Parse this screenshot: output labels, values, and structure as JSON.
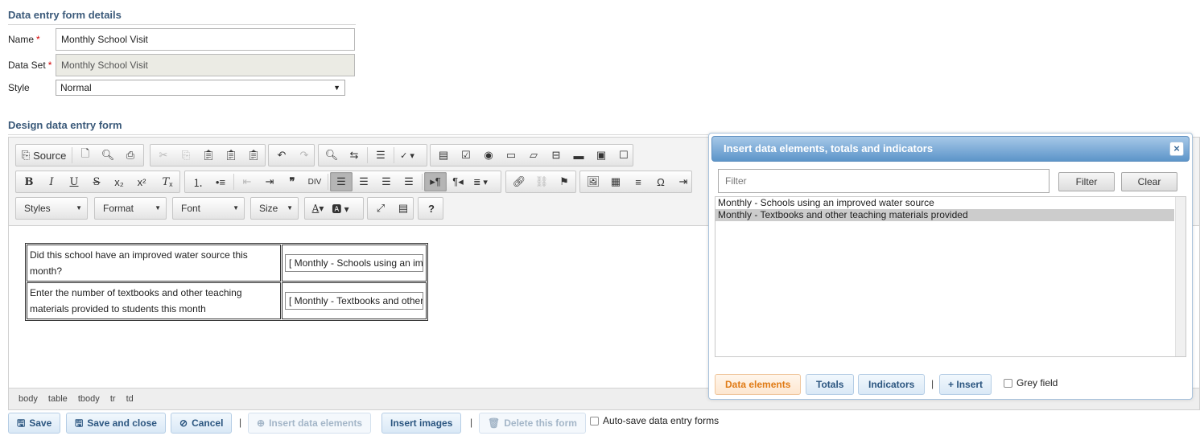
{
  "details": {
    "section_title": "Data entry form details",
    "name_label": "Name",
    "name_value": "Monthly School Visit",
    "dataset_label": "Data Set",
    "dataset_value": "Monthly School Visit",
    "style_label": "Style",
    "style_value": "Normal",
    "required_mark": "*"
  },
  "design": {
    "section_title": "Design data entry form"
  },
  "toolbar": {
    "source_label": "Source",
    "styles_label": "Styles",
    "format_label": "Format",
    "font_label": "Font",
    "size_label": "Size",
    "help_label": "?"
  },
  "form_table": {
    "rows": [
      {
        "question": "Did this school have an improved water source this month?",
        "field": "[ Monthly - Schools using an improved water source ]"
      },
      {
        "question": "Enter the number of textbooks and other teaching materials provided to students this month",
        "field": "[ Monthly - Textbooks and other teaching materials provided ]"
      }
    ]
  },
  "path_bar": [
    "body",
    "table",
    "tbody",
    "tr",
    "td"
  ],
  "bottom": {
    "save": "Save",
    "save_close": "Save and close",
    "cancel": "Cancel",
    "insert_data_elements": "Insert data elements",
    "insert_images": "Insert images",
    "delete_form": "Delete this form",
    "autosave_label": "Auto-save data entry forms",
    "separator": "|"
  },
  "dialog": {
    "title": "Insert data elements, totals and indicators",
    "close": "×",
    "filter_placeholder": "Filter",
    "filter_button": "Filter",
    "clear_button": "Clear",
    "items": [
      {
        "label": "Monthly - Schools using an improved water source",
        "selected": false
      },
      {
        "label": "Monthly - Textbooks and other teaching materials provided",
        "selected": true
      }
    ],
    "tab_data_elements": "Data elements",
    "tab_totals": "Totals",
    "tab_indicators": "Indicators",
    "separator": "|",
    "insert_button": "Insert",
    "grey_field_label": "Grey field"
  },
  "colors": {
    "section_title": "#3b5a7a",
    "required": "#d40000",
    "button_text": "#2c5680",
    "active_tab": "#e07b16",
    "dialog_header": "#5d95c9"
  }
}
